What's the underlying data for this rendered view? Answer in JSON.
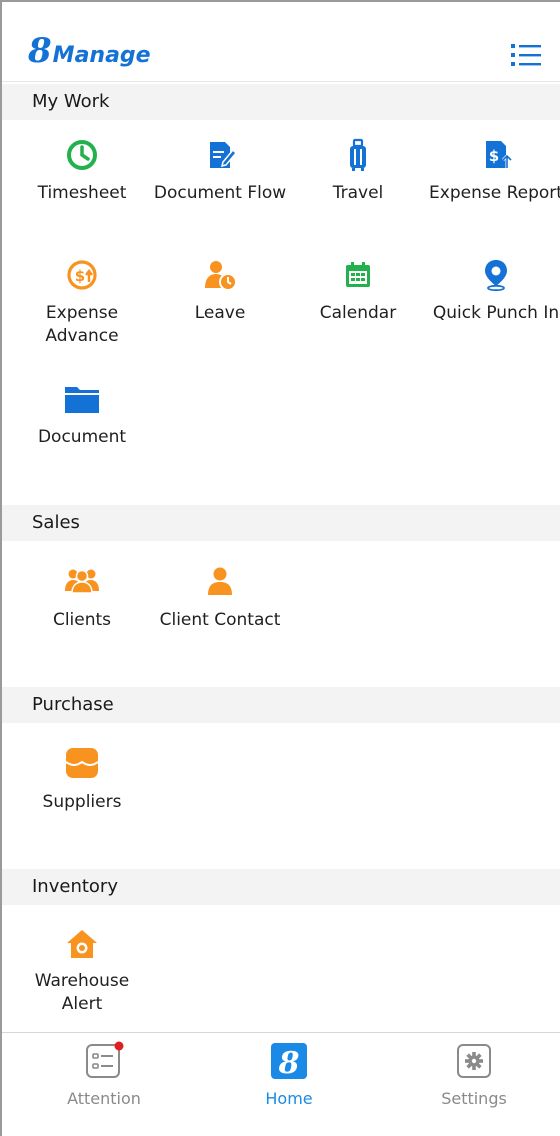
{
  "header": {
    "logo_number": "8",
    "logo_word": "Manage",
    "menu_icon": "list-menu-icon"
  },
  "sections": [
    {
      "title": "My Work",
      "items": [
        {
          "label": "Timesheet",
          "icon": "clock-icon"
        },
        {
          "label": "Document Flow",
          "icon": "document-edit-icon"
        },
        {
          "label": "Travel",
          "icon": "luggage-icon"
        },
        {
          "label": "Expense Report",
          "icon": "dollar-document-icon"
        },
        {
          "label": "Expense Advance",
          "icon": "dollar-circle-arrow-icon"
        },
        {
          "label": "Leave",
          "icon": "person-clock-icon"
        },
        {
          "label": "Calendar",
          "icon": "calendar-icon"
        },
        {
          "label": "Quick Punch In",
          "icon": "location-pin-icon"
        },
        {
          "label": "Document",
          "icon": "folder-icon"
        }
      ]
    },
    {
      "title": "Sales",
      "items": [
        {
          "label": "Clients",
          "icon": "people-group-icon"
        },
        {
          "label": "Client Contact",
          "icon": "person-icon"
        }
      ]
    },
    {
      "title": "Purchase",
      "items": [
        {
          "label": "Suppliers",
          "icon": "store-icon"
        }
      ]
    },
    {
      "title": "Inventory",
      "items": [
        {
          "label": "Warehouse Alert",
          "icon": "warehouse-alert-icon"
        }
      ]
    }
  ],
  "bottom_nav": [
    {
      "label": "Attention",
      "icon": "attention-list-icon",
      "active": false,
      "badge": true
    },
    {
      "label": "Home",
      "icon": "home-logo-icon",
      "active": true,
      "logo_char": "8"
    },
    {
      "label": "Settings",
      "icon": "gear-icon",
      "active": false
    }
  ],
  "colors": {
    "brand_blue": "#1472d6",
    "active_blue": "#1a8ae6",
    "green": "#22b14c",
    "orange": "#f7931e",
    "badge_red": "#e02020"
  }
}
